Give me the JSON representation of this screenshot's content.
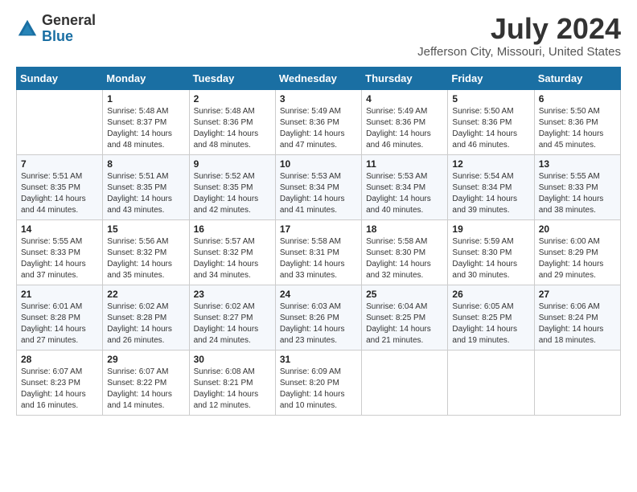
{
  "logo": {
    "general": "General",
    "blue": "Blue"
  },
  "title": "July 2024",
  "subtitle": "Jefferson City, Missouri, United States",
  "header_days": [
    "Sunday",
    "Monday",
    "Tuesday",
    "Wednesday",
    "Thursday",
    "Friday",
    "Saturday"
  ],
  "weeks": [
    [
      {
        "day": "",
        "sunrise": "",
        "sunset": "",
        "daylight": ""
      },
      {
        "day": "1",
        "sunrise": "Sunrise: 5:48 AM",
        "sunset": "Sunset: 8:37 PM",
        "daylight": "Daylight: 14 hours and 48 minutes."
      },
      {
        "day": "2",
        "sunrise": "Sunrise: 5:48 AM",
        "sunset": "Sunset: 8:36 PM",
        "daylight": "Daylight: 14 hours and 48 minutes."
      },
      {
        "day": "3",
        "sunrise": "Sunrise: 5:49 AM",
        "sunset": "Sunset: 8:36 PM",
        "daylight": "Daylight: 14 hours and 47 minutes."
      },
      {
        "day": "4",
        "sunrise": "Sunrise: 5:49 AM",
        "sunset": "Sunset: 8:36 PM",
        "daylight": "Daylight: 14 hours and 46 minutes."
      },
      {
        "day": "5",
        "sunrise": "Sunrise: 5:50 AM",
        "sunset": "Sunset: 8:36 PM",
        "daylight": "Daylight: 14 hours and 46 minutes."
      },
      {
        "day": "6",
        "sunrise": "Sunrise: 5:50 AM",
        "sunset": "Sunset: 8:36 PM",
        "daylight": "Daylight: 14 hours and 45 minutes."
      }
    ],
    [
      {
        "day": "7",
        "sunrise": "Sunrise: 5:51 AM",
        "sunset": "Sunset: 8:35 PM",
        "daylight": "Daylight: 14 hours and 44 minutes."
      },
      {
        "day": "8",
        "sunrise": "Sunrise: 5:51 AM",
        "sunset": "Sunset: 8:35 PM",
        "daylight": "Daylight: 14 hours and 43 minutes."
      },
      {
        "day": "9",
        "sunrise": "Sunrise: 5:52 AM",
        "sunset": "Sunset: 8:35 PM",
        "daylight": "Daylight: 14 hours and 42 minutes."
      },
      {
        "day": "10",
        "sunrise": "Sunrise: 5:53 AM",
        "sunset": "Sunset: 8:34 PM",
        "daylight": "Daylight: 14 hours and 41 minutes."
      },
      {
        "day": "11",
        "sunrise": "Sunrise: 5:53 AM",
        "sunset": "Sunset: 8:34 PM",
        "daylight": "Daylight: 14 hours and 40 minutes."
      },
      {
        "day": "12",
        "sunrise": "Sunrise: 5:54 AM",
        "sunset": "Sunset: 8:34 PM",
        "daylight": "Daylight: 14 hours and 39 minutes."
      },
      {
        "day": "13",
        "sunrise": "Sunrise: 5:55 AM",
        "sunset": "Sunset: 8:33 PM",
        "daylight": "Daylight: 14 hours and 38 minutes."
      }
    ],
    [
      {
        "day": "14",
        "sunrise": "Sunrise: 5:55 AM",
        "sunset": "Sunset: 8:33 PM",
        "daylight": "Daylight: 14 hours and 37 minutes."
      },
      {
        "day": "15",
        "sunrise": "Sunrise: 5:56 AM",
        "sunset": "Sunset: 8:32 PM",
        "daylight": "Daylight: 14 hours and 35 minutes."
      },
      {
        "day": "16",
        "sunrise": "Sunrise: 5:57 AM",
        "sunset": "Sunset: 8:32 PM",
        "daylight": "Daylight: 14 hours and 34 minutes."
      },
      {
        "day": "17",
        "sunrise": "Sunrise: 5:58 AM",
        "sunset": "Sunset: 8:31 PM",
        "daylight": "Daylight: 14 hours and 33 minutes."
      },
      {
        "day": "18",
        "sunrise": "Sunrise: 5:58 AM",
        "sunset": "Sunset: 8:30 PM",
        "daylight": "Daylight: 14 hours and 32 minutes."
      },
      {
        "day": "19",
        "sunrise": "Sunrise: 5:59 AM",
        "sunset": "Sunset: 8:30 PM",
        "daylight": "Daylight: 14 hours and 30 minutes."
      },
      {
        "day": "20",
        "sunrise": "Sunrise: 6:00 AM",
        "sunset": "Sunset: 8:29 PM",
        "daylight": "Daylight: 14 hours and 29 minutes."
      }
    ],
    [
      {
        "day": "21",
        "sunrise": "Sunrise: 6:01 AM",
        "sunset": "Sunset: 8:28 PM",
        "daylight": "Daylight: 14 hours and 27 minutes."
      },
      {
        "day": "22",
        "sunrise": "Sunrise: 6:02 AM",
        "sunset": "Sunset: 8:28 PM",
        "daylight": "Daylight: 14 hours and 26 minutes."
      },
      {
        "day": "23",
        "sunrise": "Sunrise: 6:02 AM",
        "sunset": "Sunset: 8:27 PM",
        "daylight": "Daylight: 14 hours and 24 minutes."
      },
      {
        "day": "24",
        "sunrise": "Sunrise: 6:03 AM",
        "sunset": "Sunset: 8:26 PM",
        "daylight": "Daylight: 14 hours and 23 minutes."
      },
      {
        "day": "25",
        "sunrise": "Sunrise: 6:04 AM",
        "sunset": "Sunset: 8:25 PM",
        "daylight": "Daylight: 14 hours and 21 minutes."
      },
      {
        "day": "26",
        "sunrise": "Sunrise: 6:05 AM",
        "sunset": "Sunset: 8:25 PM",
        "daylight": "Daylight: 14 hours and 19 minutes."
      },
      {
        "day": "27",
        "sunrise": "Sunrise: 6:06 AM",
        "sunset": "Sunset: 8:24 PM",
        "daylight": "Daylight: 14 hours and 18 minutes."
      }
    ],
    [
      {
        "day": "28",
        "sunrise": "Sunrise: 6:07 AM",
        "sunset": "Sunset: 8:23 PM",
        "daylight": "Daylight: 14 hours and 16 minutes."
      },
      {
        "day": "29",
        "sunrise": "Sunrise: 6:07 AM",
        "sunset": "Sunset: 8:22 PM",
        "daylight": "Daylight: 14 hours and 14 minutes."
      },
      {
        "day": "30",
        "sunrise": "Sunrise: 6:08 AM",
        "sunset": "Sunset: 8:21 PM",
        "daylight": "Daylight: 14 hours and 12 minutes."
      },
      {
        "day": "31",
        "sunrise": "Sunrise: 6:09 AM",
        "sunset": "Sunset: 8:20 PM",
        "daylight": "Daylight: 14 hours and 10 minutes."
      },
      {
        "day": "",
        "sunrise": "",
        "sunset": "",
        "daylight": ""
      },
      {
        "day": "",
        "sunrise": "",
        "sunset": "",
        "daylight": ""
      },
      {
        "day": "",
        "sunrise": "",
        "sunset": "",
        "daylight": ""
      }
    ]
  ]
}
